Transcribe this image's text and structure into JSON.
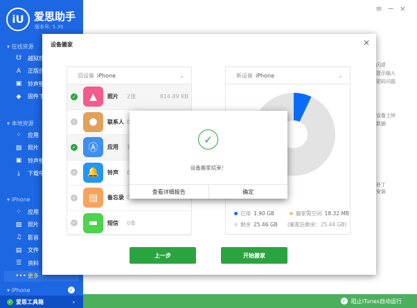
{
  "app": {
    "logo": "iU",
    "name": "爱思助手",
    "version": "版本号: 5.38"
  },
  "sidebar": {
    "sections": [
      {
        "title": "在线资源",
        "items": [
          {
            "label": "越狱应",
            "icon": "jailbreak-icon"
          },
          {
            "label": "正版应",
            "icon": "appstore-icon"
          },
          {
            "label": "铃声壁",
            "icon": "ringtone-icon"
          },
          {
            "label": "固件下",
            "icon": "firmware-icon"
          }
        ]
      },
      {
        "title": "本地资源",
        "items": [
          {
            "label": "应用",
            "icon": "apps-icon"
          },
          {
            "label": "照片",
            "icon": "photo-icon"
          },
          {
            "label": "铃声壁",
            "icon": "ringtone-icon"
          },
          {
            "label": "下载中",
            "icon": "download-icon"
          }
        ]
      },
      {
        "title": "iPhone",
        "items": [
          {
            "label": "应用",
            "icon": "apps-icon"
          },
          {
            "label": "照片",
            "icon": "photo-icon"
          },
          {
            "label": "影音",
            "icon": "media-icon"
          },
          {
            "label": "文件",
            "icon": "file-icon"
          },
          {
            "label": "资料",
            "icon": "info-icon"
          },
          {
            "label": "更多",
            "icon": "more-icon"
          }
        ]
      }
    ],
    "device": "iPhone",
    "toolbox": "爱思工具箱"
  },
  "background_text": [
    "闪退",
    "提示输入",
    "密码问题",
    "设备上除",
    "数据",
    "补丁",
    "安装"
  ],
  "footer": {
    "itunes": "阻止iTunes自动运行"
  },
  "dialog": {
    "title": "设备搬家",
    "old_device": {
      "label": "旧设备",
      "name": "iPhone"
    },
    "new_device": {
      "label": "新设备",
      "name": "iPhone"
    },
    "items": [
      {
        "name": "照片",
        "count": "2张",
        "size": "814.89 KB",
        "checked": true,
        "color": "#f45a8d",
        "icon": "photos-icon"
      },
      {
        "name": "联系人",
        "count": "0",
        "size": "",
        "checked": false,
        "color": "#e0a25a",
        "icon": "contacts-icon"
      },
      {
        "name": "应用",
        "count": "1",
        "size": "",
        "checked": true,
        "color": "#3d8ff0",
        "icon": "appstore-icon"
      },
      {
        "name": "铃声",
        "count": "0",
        "size": "",
        "checked": false,
        "color": "#2196f3",
        "icon": "bell-icon"
      },
      {
        "name": "备忘录",
        "count": "0",
        "size": "",
        "checked": false,
        "color": "#f7a35c",
        "icon": "notes-icon"
      },
      {
        "name": "短信",
        "count": "0条",
        "size": "",
        "checked": false,
        "color": "#4cd44c",
        "icon": "message-icon"
      }
    ],
    "storage": {
      "used_label": "已用",
      "used": "1.90 GB",
      "need_label": "搬家需空间",
      "need": "18.32 MB",
      "free_label": "剩余",
      "free": "25.46 GB",
      "after": "(搬家后剩余：25.44 GB)",
      "used_fraction": 0.07,
      "colors": {
        "used": "#0a6cf5",
        "need": "#f7c27a",
        "free": "#e3e3e3"
      }
    },
    "prev_button": "上一步",
    "start_button": "开始搬家"
  },
  "popup": {
    "message": "设备搬家结束！",
    "report_button": "查看详细报告",
    "ok_button": "确定"
  }
}
